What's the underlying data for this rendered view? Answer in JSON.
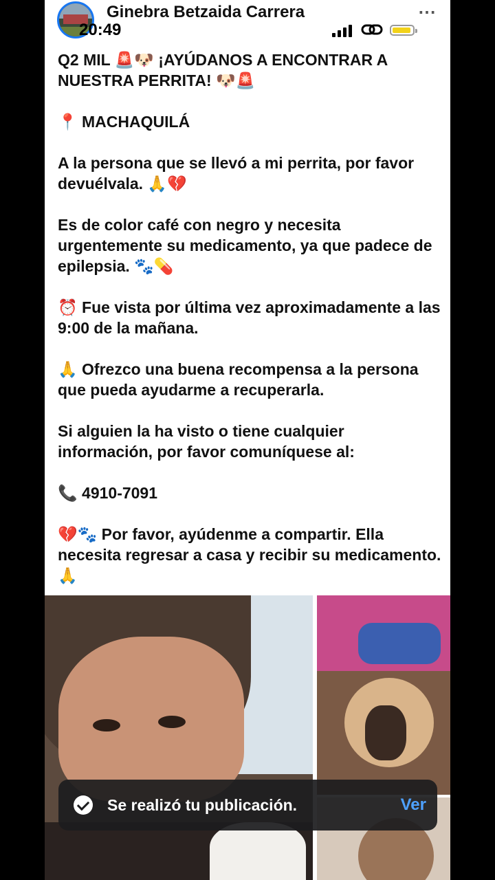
{
  "status_bar": {
    "time": "20:49"
  },
  "post": {
    "author": "Ginebra Betzaida Carrera",
    "more_icon": "⋯",
    "paragraphs": [
      "Q2 MIL 🚨🐶 ¡AYÚDANOS A ENCONTRAR A NUESTRA PERRITA! 🐶🚨",
      "📍 MACHAQUILÁ",
      "A la persona que se llevó a mi perrita, por favor devuélvala. 🙏💔",
      "Es de color café con negro y necesita urgentemente su medicamento, ya que padece de epilepsia. 🐾💊",
      "⏰ Fue vista por última vez aproximadamente a las 9:00 de la mañana.",
      "🙏 Ofrezco una buena recompensa a la persona que pueda ayudarme a recuperarla.",
      "Si alguien la ha visto o tiene cualquier información, por favor comuníquese al:",
      "📞 4910-7091",
      "💔🐾 Por favor, ayúdenme a compartir. Ella necesita regresar a casa y recibir su medicamento. 🙏"
    ]
  },
  "toast": {
    "message": "Se realizó tu publicación.",
    "action": "Ver"
  },
  "colors": {
    "accent": "#1877f2",
    "toast_bg": "#1c1c1e",
    "toast_action": "#4ea1ff",
    "battery": "#f2d21a"
  },
  "icons": [
    "avatar",
    "more-icon",
    "signal-icon",
    "link-icon",
    "battery-icon",
    "check-icon"
  ]
}
